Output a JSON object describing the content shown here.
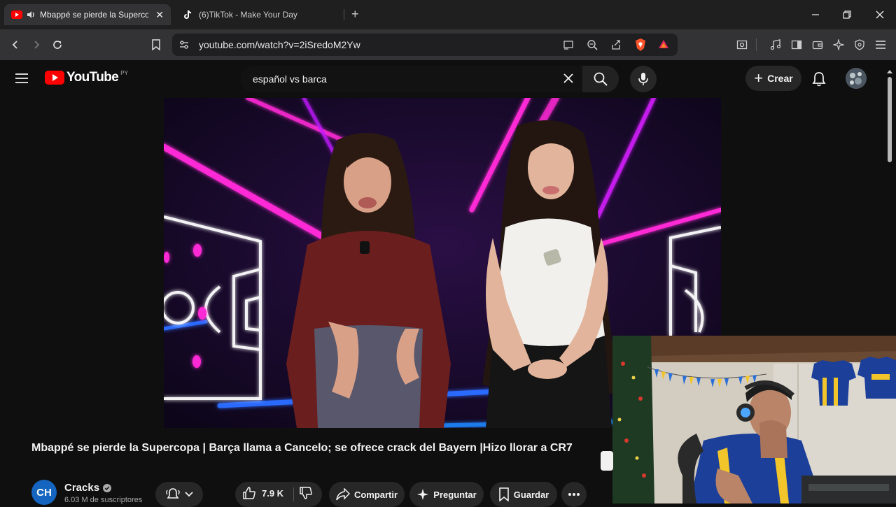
{
  "browser": {
    "tabs": [
      {
        "title": "Mbappé se pierde la Supercop",
        "active": true
      },
      {
        "title": "(6)TikTok - Make Your Day",
        "active": false
      }
    ],
    "url": "youtube.com/watch?v=2iSredoM2Yw"
  },
  "youtube": {
    "logo_text": "YouTube",
    "country_code": "PY",
    "search_query": "español vs barca",
    "create_label": "Crear"
  },
  "video": {
    "title": "Mbappé se pierde la Supercopa | Barça llama a Cancelo; se ofrece crack del Bayern |Hizo llorar a CR7",
    "channel": {
      "name": "Cracks",
      "avatar_text": "CH",
      "subscribers": "6.03 M de suscriptores"
    },
    "actions": {
      "likes": "7.9 K",
      "share_label": "Compartir",
      "ask_label": "Preguntar",
      "save_label": "Guardar"
    }
  },
  "colors": {
    "yt_red": "#ff0000",
    "background": "#0f0f0f",
    "chrome_dark": "#1f1f1f",
    "chrome_toolbar": "#333335",
    "brave_orange": "#fb542b",
    "neon_pink": "#ff2bd6",
    "neon_blue": "#2b6bff"
  }
}
